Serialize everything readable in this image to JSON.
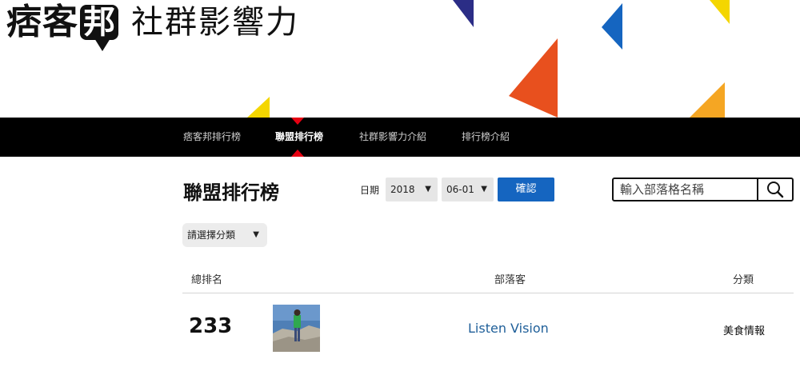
{
  "header": {
    "logo_text": "痞客",
    "logo_bubble": "邦",
    "logo_sub": "社群影響力"
  },
  "nav": {
    "items": [
      {
        "label": "痞客邦排行榜",
        "active": false
      },
      {
        "label": "聯盟排行榜",
        "active": true
      },
      {
        "label": "社群影響力介紹",
        "active": false
      },
      {
        "label": "排行榜介紹",
        "active": false
      }
    ]
  },
  "page": {
    "title": "聯盟排行榜",
    "date_label": "日期",
    "year_value": "2018",
    "day_value": "06-01",
    "confirm_label": "確認",
    "search_placeholder": "輸入部落格名稱",
    "category_select": "請選擇分類"
  },
  "table": {
    "headers": {
      "rank": "總排名",
      "blogger": "部落客",
      "category": "分類"
    },
    "rows": [
      {
        "rank": "233",
        "blog_name": "Listen Vision",
        "category": "美食情報"
      }
    ]
  },
  "colors": {
    "nav_bg": "#000000",
    "accent_red": "#e60012",
    "confirm_blue": "#1565c0",
    "link_blue": "#1f5f99"
  }
}
